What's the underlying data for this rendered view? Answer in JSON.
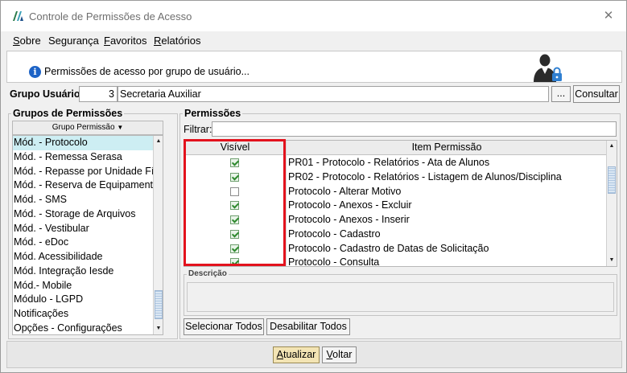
{
  "window": {
    "title": "Controle de Permissões de Acesso",
    "close_symbol": "✕"
  },
  "menu": {
    "items": [
      {
        "label": "Sobre",
        "accel": "S"
      },
      {
        "label": "Segurança",
        "accel": "g"
      },
      {
        "label": "Favoritos",
        "accel": "F"
      },
      {
        "label": "Relatórios",
        "accel": "R"
      }
    ]
  },
  "banner": {
    "text": "Permissões de acesso por grupo de usuário...",
    "icon": "info-icon",
    "right_icon": "user-lock-icon"
  },
  "grupo_usuario": {
    "label": "Grupo Usuário:",
    "code": "3",
    "name": "Secretaria Auxiliar",
    "lookup_label": "...",
    "consultar_label": "Consultar"
  },
  "grupos_permissoes": {
    "title": "Grupos de Permissões",
    "column_header": "Grupo Permissão",
    "sort_icon": "▼",
    "selected_index": 0,
    "items": [
      "Mód. - Protocolo",
      "Mód. - Remessa Serasa",
      "Mód. - Repasse por Unidade Físic...",
      "Mód. - Reserva de Equipamentos",
      "Mód. - SMS",
      "Mód. - Storage de Arquivos",
      "Mód. - Vestibular",
      "Mód. - eDoc",
      "Mód. Acessibilidade",
      "Mód. Integração Iesde",
      "Mód.- Mobile",
      "Módulo - LGPD",
      "Notificações",
      "Opções - Configurações"
    ]
  },
  "permissoes": {
    "title": "Permissões",
    "filter_label": "Filtrar:",
    "filter_value": "",
    "columns": [
      "Visível",
      "Item Permissão"
    ],
    "rows": [
      {
        "visible": true,
        "item": "PR01 - Protocolo - Relatórios - Ata de Alunos"
      },
      {
        "visible": true,
        "item": "PR02 - Protocolo - Relatórios - Listagem de Alunos/Disciplina"
      },
      {
        "visible": false,
        "item": "Protocolo - Alterar Motivo"
      },
      {
        "visible": true,
        "item": "Protocolo - Anexos - Excluir"
      },
      {
        "visible": true,
        "item": "Protocolo - Anexos - Inserir"
      },
      {
        "visible": true,
        "item": "Protocolo - Cadastro"
      },
      {
        "visible": true,
        "item": "Protocolo - Cadastro de Datas de Solicitação"
      },
      {
        "visible": true,
        "item": "Protocolo - Consulta"
      }
    ],
    "highlight_color": "#e3121d",
    "descricao_label": "Descrição",
    "descricao_value": "",
    "selecionar_todos_label": "Selecionar Todos",
    "desabilitar_todos_label": "Desabilitar Todos"
  },
  "footer": {
    "atualizar_label": "Atualizar",
    "atualizar_accel": "A",
    "voltar_label": "Voltar",
    "voltar_accel": "V"
  },
  "colors": {
    "selected_row": "#cdeef3",
    "primary_button": "#f3e4b4",
    "check_green": "#2f8a2f"
  }
}
